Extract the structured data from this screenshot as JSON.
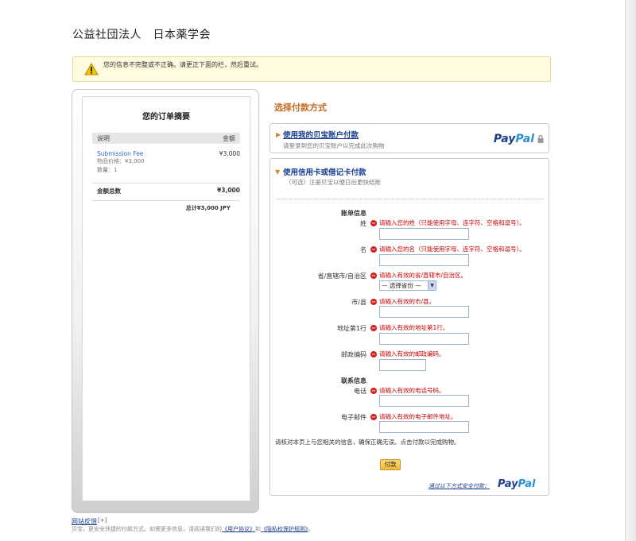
{
  "merchant": "公益社団法人　日本薬学会",
  "alert": {
    "text": "您的信息不完整或不正确。请更正下面的栏，然后重试。"
  },
  "summary": {
    "title": "您的订单摘要",
    "col_desc": "说明",
    "col_amount": "金额",
    "item_name": "Submission Fee",
    "item_amount": "¥3,000",
    "item_price": "物品价格：¥3,000",
    "item_qty": "数量：1",
    "subtotal_label": "金额总数",
    "subtotal_amount": "¥3,000",
    "grand_total": "总计¥3,000 JPY"
  },
  "payment": {
    "title": "选择付款方式",
    "paypal_link": "使用我的贝宝账户付款",
    "paypal_sub": "请登录到您的贝宝账户以完成此次购物",
    "paypal_logo_a": "Pay",
    "paypal_logo_b": "Pal",
    "card_title": "使用信用卡或借记卡付款",
    "card_sub": "（可选）注册贝宝以便日后更快结账",
    "billing_label": "账单信息",
    "fields": [
      {
        "label": "姓",
        "error": "请输入您的姓（只能使用字母、连字符、空格和逗号）。"
      },
      {
        "label": "名",
        "error": "请输入您的名（只能使用字母、连字符、空格和逗号）。"
      },
      {
        "label": "省/直辖市/自治区",
        "error": "请输入有效的省/直辖市/自治区。",
        "select": "— 选择省份 —"
      },
      {
        "label": "市/县",
        "error": "请输入有效的市/县。"
      },
      {
        "label": "地址第1行",
        "error": "请输入有效的地址第1行。"
      },
      {
        "label": "邮政编码",
        "error": "请输入有效的邮政编码。"
      }
    ],
    "contact_label": "联系信息",
    "contact_fields": [
      {
        "label": "电话",
        "error": "请输入有效的电话号码。"
      },
      {
        "label": "电子邮件",
        "error": "请输入有效的电子邮件地址。"
      }
    ],
    "confirm_text": "请核对本页上与您相关的信息，确保正确无误。点击付款以完成购物。",
    "pay_button": "付款",
    "secure_text": "通过以下方式安全付款："
  },
  "footer": {
    "feedback": "网站反馈",
    "feedback_mark": "[+]",
    "text_prefix": "贝宝，更安全快捷的付款方式。如需更多信息，请阅读我们的",
    "user_agreement": "《用户协议》",
    "and": "和",
    "privacy": "《隐私权保护规则》",
    "period": "。"
  }
}
